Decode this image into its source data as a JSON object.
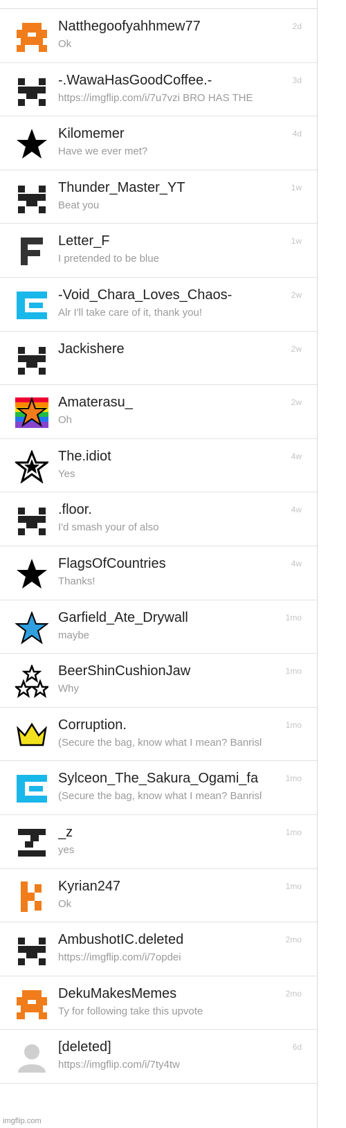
{
  "conversations": [
    {
      "name": "Natthegoofyahhmew77",
      "message": "Ok",
      "time": "2d",
      "avatar": "orange-pixel-avatar-icon",
      "color": "#f07c1b"
    },
    {
      "name": "-.WawaHasGoodCoffee.-",
      "message": "https://imgflip.com/i/7u7vzi BRO HAS THE",
      "time": "3d",
      "avatar": "black-pixel-avatar-icon",
      "color": "#222222"
    },
    {
      "name": "Kilomemer",
      "message": "Have we ever met?",
      "time": "4d",
      "avatar": "black-star-icon",
      "color": "#000000"
    },
    {
      "name": "Thunder_Master_YT",
      "message": "Beat you",
      "time": "1w",
      "avatar": "black-pixel-avatar-icon",
      "color": "#222222"
    },
    {
      "name": "Letter_F",
      "message": "I pretended to be blue",
      "time": "1w",
      "avatar": "letter-f-icon",
      "color": "#333333"
    },
    {
      "name": "-Void_Chara_Loves_Chaos-",
      "message": "Alr I'll take care of it, thank you!",
      "time": "2w",
      "avatar": "cyan-pixel-avatar-icon",
      "color": "#1ab7ea"
    },
    {
      "name": "Jackishere",
      "message": "",
      "time": "2w",
      "avatar": "black-pixel-avatar-icon",
      "color": "#222222"
    },
    {
      "name": "Amaterasu_",
      "message": "Oh",
      "time": "2w",
      "avatar": "rainbow-star-icon",
      "color": "#f07c1b"
    },
    {
      "name": "The.idiot",
      "message": "Yes",
      "time": "4w",
      "avatar": "outlined-star-icon",
      "color": "#000000"
    },
    {
      "name": ".floor.",
      "message": "I'd smash your of also",
      "time": "4w",
      "avatar": "black-pixel-avatar-icon",
      "color": "#222222"
    },
    {
      "name": "FlagsOfCountries",
      "message": "Thanks!",
      "time": "4w",
      "avatar": "black-star-icon",
      "color": "#000000"
    },
    {
      "name": "Garfield_Ate_Drywall",
      "message": "maybe",
      "time": "1mo",
      "avatar": "blue-star-icon",
      "color": "#2f9fe0"
    },
    {
      "name": "BeerShinCushionJaw",
      "message": "Why",
      "time": "1mo",
      "avatar": "three-stars-icon",
      "color": "#000000"
    },
    {
      "name": "Corruption.",
      "message": "(Secure the bag, know what I mean? Banrisl",
      "time": "1mo",
      "avatar": "crown-icon",
      "color": "#f2e11d"
    },
    {
      "name": "Sylceon_The_Sakura_Ogami_fa",
      "message": "(Secure the bag, know what I mean? Banrisl",
      "time": "1mo",
      "avatar": "cyan-pixel-avatar-icon",
      "color": "#1ab7ea"
    },
    {
      "name": "_z",
      "message": "yes",
      "time": "1mo",
      "avatar": "letter-z-icon",
      "color": "#222222"
    },
    {
      "name": "Kyrian247",
      "message": "Ok",
      "time": "1mo",
      "avatar": "orange-k-icon",
      "color": "#f07c1b"
    },
    {
      "name": "AmbushotIC.deleted",
      "message": "https://imgflip.com/i/7opdei",
      "time": "2mo",
      "avatar": "black-pixel-avatar-icon",
      "color": "#222222"
    },
    {
      "name": "DekuMakesMemes",
      "message": "Ty for following take this upvote",
      "time": "2mo",
      "avatar": "orange-pixel-avatar-icon",
      "color": "#f07c1b"
    },
    {
      "name": "[deleted]",
      "message": "https://imgflip.com/i/7ty4tw",
      "time": "6d",
      "avatar": "default-user-icon",
      "color": "#cfcfcf"
    }
  ],
  "footer": {
    "watermark": "imgflip.com"
  }
}
